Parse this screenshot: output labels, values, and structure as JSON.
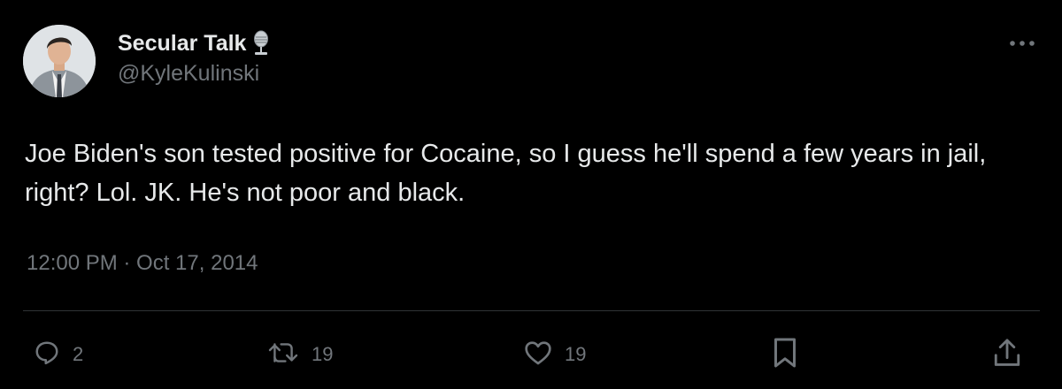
{
  "author": {
    "display_name": "Secular Talk",
    "handle": "@KyleKulinski",
    "badge_icon": "microphone-icon"
  },
  "tweet": {
    "text": "Joe Biden's son tested positive for Cocaine, so I guess he'll spend a few years in jail, right? Lol. JK. He's not poor and black.",
    "timestamp": "12:00 PM · Oct 17, 2014"
  },
  "actions": {
    "reply_count": "2",
    "retweet_count": "19",
    "like_count": "19"
  },
  "colors": {
    "background": "#000000",
    "text_primary": "#e7e9ea",
    "text_secondary": "#71767b",
    "divider": "#2f3336"
  }
}
